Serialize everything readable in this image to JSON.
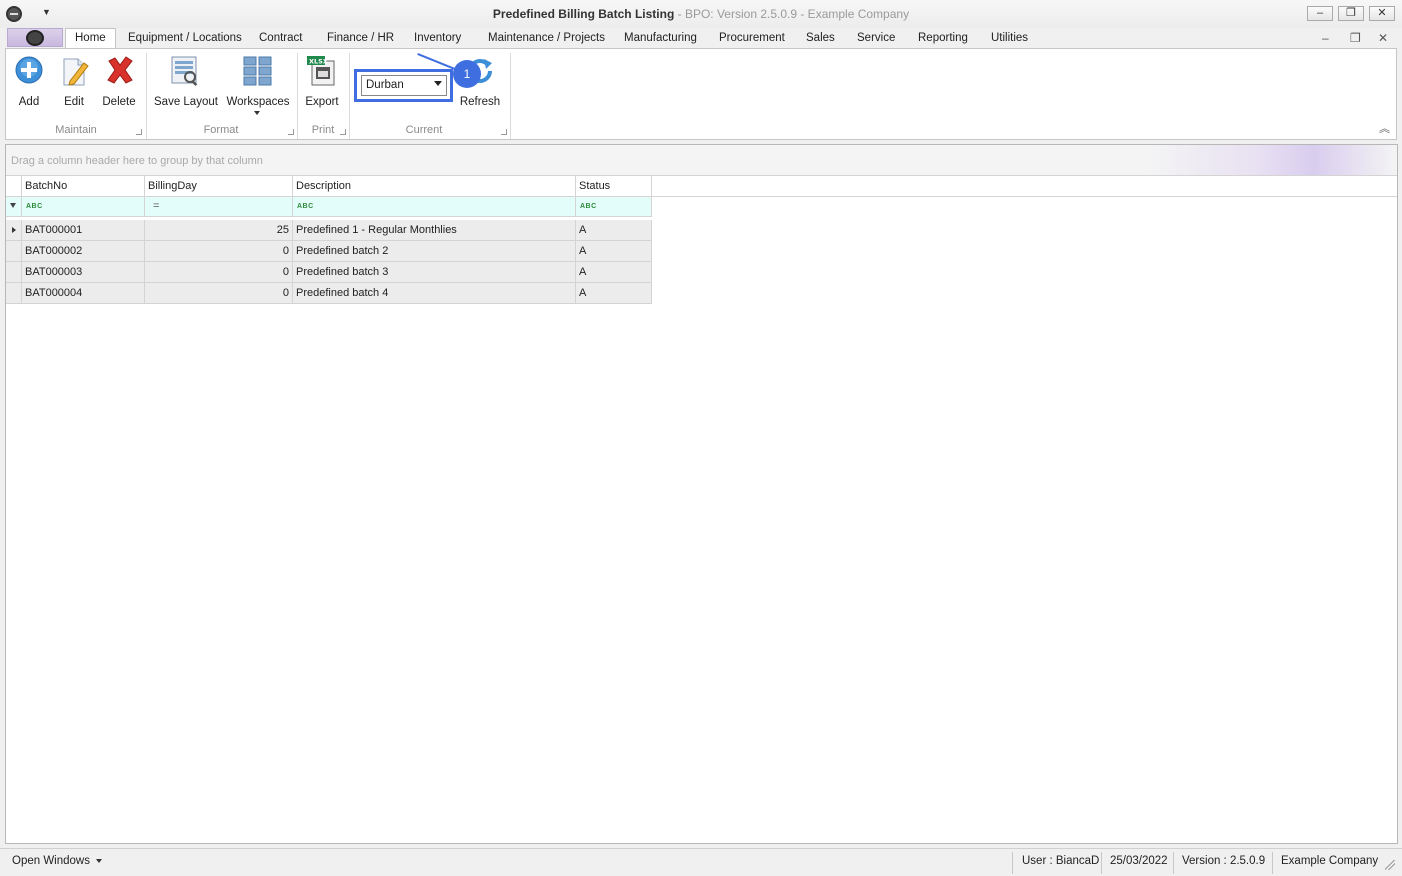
{
  "window": {
    "title": "Predefined Billing Batch Listing",
    "subtitle": "- BPO: Version 2.5.0.9 - Example Company",
    "minimize": "–",
    "restore": "❐",
    "close": "✕"
  },
  "ribbon_tabs": [
    "Home",
    "Equipment / Locations",
    "Contract",
    "Finance / HR",
    "Inventory",
    "Maintenance / Projects",
    "Manufacturing",
    "Procurement",
    "Sales",
    "Service",
    "Reporting",
    "Utilities"
  ],
  "mdi": {
    "minimize": "–",
    "restore": "❐",
    "close": "✕"
  },
  "ribbon": {
    "maintain": {
      "group": "Maintain",
      "add": "Add",
      "edit": "Edit",
      "delete": "Delete"
    },
    "format": {
      "group": "Format",
      "save_layout": "Save Layout",
      "workspaces": "Workspaces"
    },
    "print": {
      "group": "Print",
      "export": "Export"
    },
    "current": {
      "group": "Current",
      "branch": "Durban",
      "refresh": "Refresh"
    },
    "callout_number": "1"
  },
  "grid": {
    "group_panel_text": "Drag a column header here to group by that column",
    "columns": [
      "BatchNo",
      "BillingDay",
      "Description",
      "Status"
    ],
    "filter": {
      "equals": "=",
      "abc": "ABC"
    },
    "rows": [
      {
        "batch_no": "BAT000001",
        "billing_day": "25",
        "description": "Predefined 1 - Regular Monthlies",
        "status": "A"
      },
      {
        "batch_no": "BAT000002",
        "billing_day": "0",
        "description": "Predefined batch 2",
        "status": "A"
      },
      {
        "batch_no": "BAT000003",
        "billing_day": "0",
        "description": "Predefined batch 3",
        "status": "A"
      },
      {
        "batch_no": "BAT000004",
        "billing_day": "0",
        "description": "Predefined batch 4",
        "status": "A"
      }
    ]
  },
  "statusbar": {
    "open_windows": "Open Windows",
    "user": "User : BiancaD",
    "date": "25/03/2022",
    "version": "Version : 2.5.0.9",
    "company": "Example Company"
  },
  "colors": {
    "accent": "#3e6ee0",
    "filter_row": "#e2fdfa",
    "row_bg": "#ececec"
  }
}
